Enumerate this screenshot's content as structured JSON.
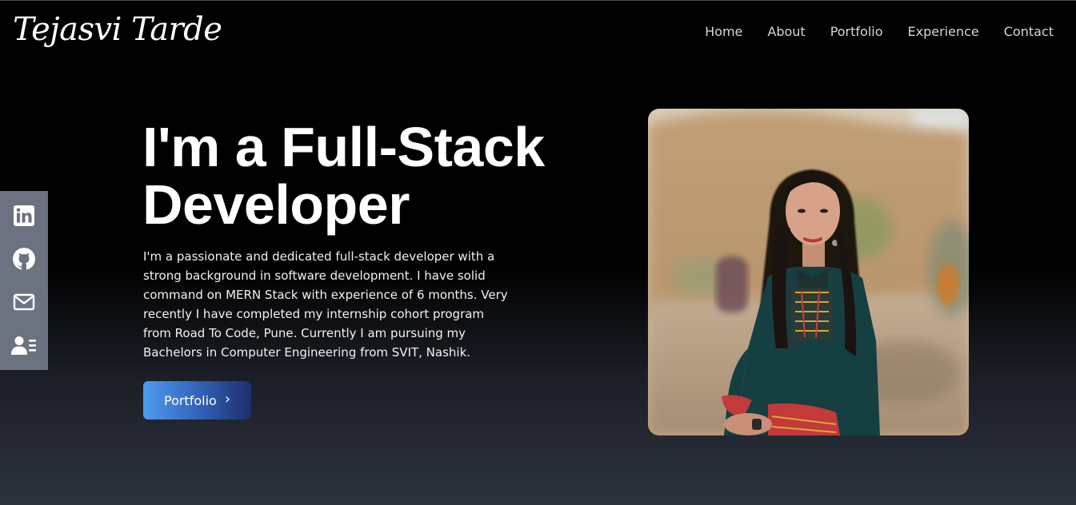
{
  "header": {
    "logo_text": "Tejasvi Tarde",
    "nav": [
      {
        "label": "Home"
      },
      {
        "label": "About"
      },
      {
        "label": "Portfolio"
      },
      {
        "label": "Experience"
      },
      {
        "label": "Contact"
      }
    ]
  },
  "sidebar": {
    "links": [
      {
        "icon": "linkedin-icon"
      },
      {
        "icon": "github-icon"
      },
      {
        "icon": "mail-icon"
      },
      {
        "icon": "resume-icon"
      }
    ]
  },
  "hero": {
    "headline_line1": "I'm a Full-Stack",
    "headline_line2": "Developer",
    "intro": "I'm a passionate and dedicated full-stack developer with a strong background in software development. I have solid command on MERN Stack with experience of 6 months. Very recently I have completed my internship cohort program from Road To Code, Pune. Currently I am pursuing my Bachelors in Computer Engineering from SVIT, Nashik.",
    "cta_label": "Portfolio",
    "cta_arrow": "›"
  },
  "colors": {
    "background_top": "#000000",
    "background_bottom": "#2d323e",
    "sidebar_bg": "#6b7280",
    "button_gradient_start": "#4f9bf0",
    "button_gradient_end": "#1e2e6b"
  }
}
